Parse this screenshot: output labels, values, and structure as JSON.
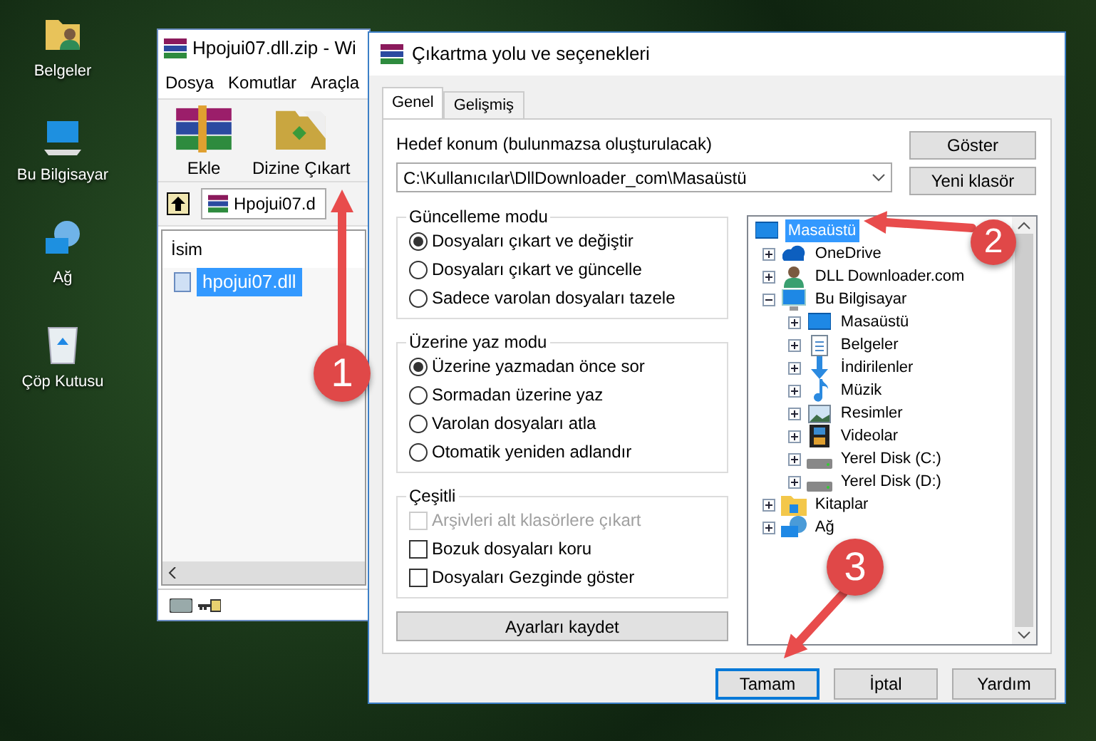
{
  "desktop_icons": [
    {
      "label": "Belgeler",
      "kind": "documents"
    },
    {
      "label": "Bu Bilgisayar",
      "kind": "computer"
    },
    {
      "label": "Ağ",
      "kind": "network"
    },
    {
      "label": "Çöp Kutusu",
      "kind": "bin"
    }
  ],
  "archive_window": {
    "title": "Hpojui07.dll.zip - Wi",
    "menu": [
      "Dosya",
      "Komutlar",
      "Araçla"
    ],
    "toolbar": [
      "Ekle",
      "Dizine Çıkart"
    ],
    "path": "Hpojui07.d",
    "columns": [
      "İsim"
    ],
    "files": [
      {
        "name": "hpojui07.dll",
        "selected": true
      }
    ]
  },
  "dialog": {
    "title": "Çıkartma yolu ve seçenekleri",
    "tabs": [
      {
        "label": "Genel",
        "selected": true
      },
      {
        "label": "Gelişmiş",
        "selected": false
      }
    ],
    "destination_label": "Hedef konum (bulunmazsa oluşturulacak)",
    "destination": "C:\\Kullanıcılar\\DllDownloader_com\\Masaüstü",
    "side_buttons": [
      "Göster",
      "Yeni klasör"
    ],
    "groups": [
      {
        "title": "Güncelleme modu",
        "kind": "radio",
        "options": [
          {
            "label": "Dosyaları çıkart ve değiştir",
            "selected": true,
            "disabled": false
          },
          {
            "label": "Dosyaları çıkart ve güncelle",
            "selected": false,
            "disabled": false
          },
          {
            "label": "Sadece varolan dosyaları tazele",
            "selected": false,
            "disabled": false
          }
        ]
      },
      {
        "title": "Üzerine yaz modu",
        "kind": "radio",
        "options": [
          {
            "label": "Üzerine yazmadan önce sor",
            "selected": true,
            "disabled": false
          },
          {
            "label": "Sormadan üzerine yaz",
            "selected": false,
            "disabled": false
          },
          {
            "label": "Varolan dosyaları atla",
            "selected": false,
            "disabled": false
          },
          {
            "label": "Otomatik yeniden adlandır",
            "selected": false,
            "disabled": false
          }
        ]
      },
      {
        "title": "Çeşitli",
        "kind": "checkbox",
        "options": [
          {
            "label": "Arşivleri alt klasörlere çıkart",
            "checked": false,
            "disabled": true
          },
          {
            "label": "Bozuk dosyaları koru",
            "checked": false,
            "disabled": false
          },
          {
            "label": "Dosyaları Gezginde göster",
            "checked": false,
            "disabled": false
          }
        ]
      }
    ],
    "save_button": "Ayarları kaydet",
    "tree": [
      {
        "label": "Masaüstü",
        "kind": "desktop",
        "selected": true,
        "children": [
          {
            "label": "OneDrive",
            "kind": "cloud",
            "selected": false,
            "expanded": false
          },
          {
            "label": "DLL Downloader.com",
            "kind": "user",
            "selected": false,
            "expanded": false
          },
          {
            "label": "Bu Bilgisayar",
            "kind": "computer",
            "selected": false,
            "expanded": true,
            "children": [
              {
                "label": "Masaüstü",
                "kind": "desktop",
                "selected": false,
                "expanded": false
              },
              {
                "label": "Belgeler",
                "kind": "document",
                "selected": false,
                "expanded": false
              },
              {
                "label": "İndirilenler",
                "kind": "download",
                "selected": false,
                "expanded": false
              },
              {
                "label": "Müzik",
                "kind": "music",
                "selected": false,
                "expanded": false
              },
              {
                "label": "Resimler",
                "kind": "picture",
                "selected": false,
                "expanded": false
              },
              {
                "label": "Videolar",
                "kind": "video",
                "selected": false,
                "expanded": false
              },
              {
                "label": "Yerel Disk (C:)",
                "kind": "drive",
                "selected": false,
                "expanded": false
              },
              {
                "label": "Yerel Disk (D:)",
                "kind": "drive",
                "selected": false,
                "expanded": false
              }
            ]
          },
          {
            "label": "Kitaplar",
            "kind": "library",
            "selected": false,
            "expanded": false
          },
          {
            "label": "Ağ",
            "kind": "network",
            "selected": false,
            "expanded": false
          }
        ]
      }
    ],
    "buttons": [
      {
        "label": "Tamam",
        "default": true
      },
      {
        "label": "İptal",
        "default": false
      },
      {
        "label": "Yardım",
        "default": false
      }
    ]
  },
  "annotations": [
    {
      "label": "1"
    },
    {
      "label": "2"
    },
    {
      "label": "3"
    }
  ]
}
